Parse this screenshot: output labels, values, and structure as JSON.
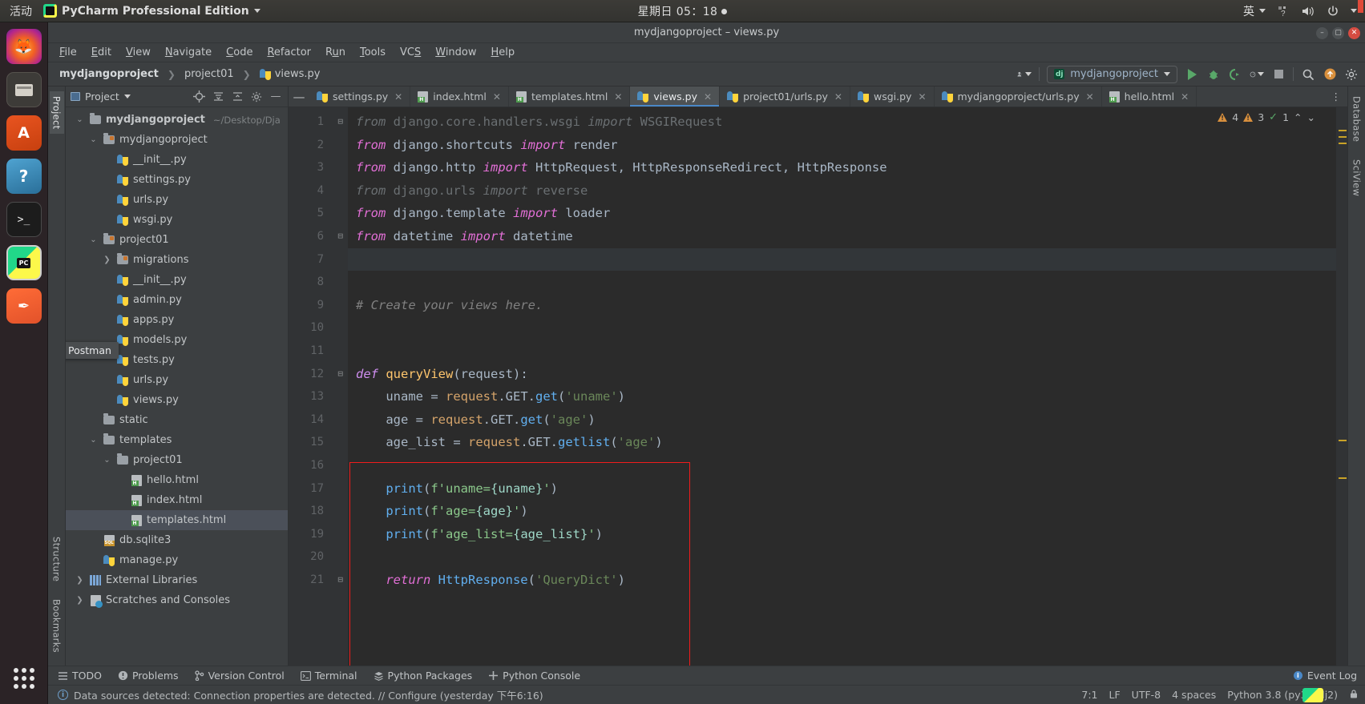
{
  "gnome": {
    "activities": "活动",
    "app_name": "PyCharm Professional Edition",
    "clock": "星期日 05：18",
    "input_method": "英"
  },
  "dock": {
    "items": [
      {
        "name": "firefox",
        "glyph": "🦊"
      },
      {
        "name": "files",
        "glyph": "🗄"
      },
      {
        "name": "ubuntu-software",
        "glyph": "A"
      },
      {
        "name": "help",
        "glyph": "?"
      },
      {
        "name": "terminal",
        "glyph": "▌"
      },
      {
        "name": "pycharm",
        "glyph": "PC"
      },
      {
        "name": "postman",
        "glyph": "✒"
      }
    ]
  },
  "window": {
    "title": "mydjangoproject – views.py"
  },
  "menu": {
    "items": [
      {
        "pre": "",
        "mn": "F",
        "post": "ile"
      },
      {
        "pre": "",
        "mn": "E",
        "post": "dit"
      },
      {
        "pre": "",
        "mn": "V",
        "post": "iew"
      },
      {
        "pre": "",
        "mn": "N",
        "post": "avigate"
      },
      {
        "pre": "",
        "mn": "C",
        "post": "ode"
      },
      {
        "pre": "",
        "mn": "R",
        "post": "efactor"
      },
      {
        "pre": "R",
        "mn": "u",
        "post": "n"
      },
      {
        "pre": "",
        "mn": "T",
        "post": "ools"
      },
      {
        "pre": "VC",
        "mn": "S",
        "post": ""
      },
      {
        "pre": "",
        "mn": "W",
        "post": "indow"
      },
      {
        "pre": "",
        "mn": "H",
        "post": "elp"
      }
    ]
  },
  "navbar": {
    "crumbs": [
      "mydjangoproject",
      "project01",
      "views.py"
    ],
    "run_config": "mydjangoproject"
  },
  "project_panel": {
    "title": "Project",
    "tree": [
      {
        "depth": 0,
        "arrow": "v",
        "icon": "folder",
        "label": "mydjangoproject",
        "path": "~/Desktop/Dja",
        "bold": true
      },
      {
        "depth": 1,
        "arrow": "v",
        "icon": "folder-mod",
        "label": "mydjangoproject",
        "path": "",
        "bold": false
      },
      {
        "depth": 2,
        "arrow": "",
        "icon": "py",
        "label": "__init__.py",
        "path": "",
        "bold": false
      },
      {
        "depth": 2,
        "arrow": "",
        "icon": "py",
        "label": "settings.py",
        "path": "",
        "bold": false
      },
      {
        "depth": 2,
        "arrow": "",
        "icon": "py",
        "label": "urls.py",
        "path": "",
        "bold": false
      },
      {
        "depth": 2,
        "arrow": "",
        "icon": "py",
        "label": "wsgi.py",
        "path": "",
        "bold": false
      },
      {
        "depth": 1,
        "arrow": "v",
        "icon": "folder-mod",
        "label": "project01",
        "path": "",
        "bold": false
      },
      {
        "depth": 2,
        "arrow": ">",
        "icon": "folder-mod",
        "label": "migrations",
        "path": "",
        "bold": false
      },
      {
        "depth": 2,
        "arrow": "",
        "icon": "py",
        "label": "__init__.py",
        "path": "",
        "bold": false
      },
      {
        "depth": 2,
        "arrow": "",
        "icon": "py",
        "label": "admin.py",
        "path": "",
        "bold": false
      },
      {
        "depth": 2,
        "arrow": "",
        "icon": "py",
        "label": "apps.py",
        "path": "",
        "bold": false
      },
      {
        "depth": 2,
        "arrow": "",
        "icon": "py",
        "label": "models.py",
        "path": "",
        "bold": false
      },
      {
        "depth": 2,
        "arrow": "",
        "icon": "py",
        "label": "tests.py",
        "path": "",
        "bold": false
      },
      {
        "depth": 2,
        "arrow": "",
        "icon": "py",
        "label": "urls.py",
        "path": "",
        "bold": false
      },
      {
        "depth": 2,
        "arrow": "",
        "icon": "py",
        "label": "views.py",
        "path": "",
        "bold": false
      },
      {
        "depth": 1,
        "arrow": "",
        "icon": "folder",
        "label": "static",
        "path": "",
        "bold": false
      },
      {
        "depth": 1,
        "arrow": "v",
        "icon": "folder",
        "label": "templates",
        "path": "",
        "bold": false
      },
      {
        "depth": 2,
        "arrow": "v",
        "icon": "folder",
        "label": "project01",
        "path": "",
        "bold": false
      },
      {
        "depth": 3,
        "arrow": "",
        "icon": "html",
        "label": "hello.html",
        "path": "",
        "bold": false
      },
      {
        "depth": 3,
        "arrow": "",
        "icon": "html",
        "label": "index.html",
        "path": "",
        "bold": false
      },
      {
        "depth": 3,
        "arrow": "",
        "icon": "html",
        "label": "templates.html",
        "path": "",
        "bold": false,
        "selected": true
      },
      {
        "depth": 1,
        "arrow": "",
        "icon": "sql",
        "label": "db.sqlite3",
        "path": "",
        "bold": false
      },
      {
        "depth": 1,
        "arrow": "",
        "icon": "py",
        "label": "manage.py",
        "path": "",
        "bold": false
      },
      {
        "depth": 0,
        "arrow": ">",
        "icon": "lib",
        "label": "External Libraries",
        "path": "",
        "bold": false
      },
      {
        "depth": 0,
        "arrow": ">",
        "icon": "scratch",
        "label": "Scratches and Consoles",
        "path": "",
        "bold": false
      }
    ],
    "tooltip": "Postman"
  },
  "left_strip": {
    "tabs": [
      "Project",
      "Structure",
      "Bookmarks"
    ]
  },
  "right_strip": {
    "tabs": [
      "Database",
      "SciView"
    ]
  },
  "tabs": [
    {
      "label": "settings.py",
      "icon": "py",
      "active": false
    },
    {
      "label": "index.html",
      "icon": "html",
      "active": false
    },
    {
      "label": "templates.html",
      "icon": "html",
      "active": false
    },
    {
      "label": "views.py",
      "icon": "py",
      "active": true
    },
    {
      "label": "project01/urls.py",
      "icon": "py",
      "active": false
    },
    {
      "label": "wsgi.py",
      "icon": "py",
      "active": false
    },
    {
      "label": "mydjangoproject/urls.py",
      "icon": "py",
      "active": false
    },
    {
      "label": "hello.html",
      "icon": "html",
      "active": false
    }
  ],
  "inspections": {
    "warnings": "4",
    "weak_warnings": "3",
    "typos": "1"
  },
  "code": {
    "lines": [
      {
        "n": 1,
        "fold": "minus",
        "tokens": [
          {
            "t": "from ",
            "c": "dim"
          },
          {
            "t": "django.core.handlers.wsgi ",
            "c": "dim2"
          },
          {
            "t": "import ",
            "c": "dim"
          },
          {
            "t": "WSGIRequest",
            "c": "dim2"
          }
        ]
      },
      {
        "n": 2,
        "fold": "",
        "tokens": [
          {
            "t": "from ",
            "c": "kw"
          },
          {
            "t": "django.shortcuts ",
            "c": "idn"
          },
          {
            "t": "import ",
            "c": "kw"
          },
          {
            "t": "render",
            "c": "idn"
          }
        ]
      },
      {
        "n": 3,
        "fold": "",
        "tokens": [
          {
            "t": "from ",
            "c": "kw"
          },
          {
            "t": "django.http ",
            "c": "idn"
          },
          {
            "t": "import ",
            "c": "kw"
          },
          {
            "t": "HttpRequest, HttpResponseRedirect, HttpResponse",
            "c": "idn"
          }
        ]
      },
      {
        "n": 4,
        "fold": "",
        "tokens": [
          {
            "t": "from ",
            "c": "dim"
          },
          {
            "t": "django.urls ",
            "c": "dim2"
          },
          {
            "t": "import ",
            "c": "dim"
          },
          {
            "t": "reverse",
            "c": "dim2"
          }
        ]
      },
      {
        "n": 5,
        "fold": "",
        "tokens": [
          {
            "t": "from ",
            "c": "kw"
          },
          {
            "t": "django.template ",
            "c": "idn"
          },
          {
            "t": "import ",
            "c": "kw"
          },
          {
            "t": "loader",
            "c": "idn"
          }
        ]
      },
      {
        "n": 6,
        "fold": "minus",
        "tokens": [
          {
            "t": "from ",
            "c": "kw"
          },
          {
            "t": "datetime ",
            "c": "idn"
          },
          {
            "t": "import ",
            "c": "kw"
          },
          {
            "t": "datetime",
            "c": "idn"
          }
        ]
      },
      {
        "n": 7,
        "fold": "",
        "tokens": [],
        "current": true
      },
      {
        "n": 8,
        "fold": "",
        "tokens": []
      },
      {
        "n": 9,
        "fold": "",
        "tokens": [
          {
            "t": "# Create your views here.",
            "c": "cm"
          }
        ]
      },
      {
        "n": 10,
        "fold": "",
        "tokens": []
      },
      {
        "n": 11,
        "fold": "",
        "tokens": []
      },
      {
        "n": 12,
        "fold": "minus",
        "tokens": [
          {
            "t": "def ",
            "c": "kw2"
          },
          {
            "t": "queryView",
            "c": "fn"
          },
          {
            "t": "(",
            "c": "brc"
          },
          {
            "t": "request",
            "c": "idn"
          },
          {
            "t": "):",
            "c": "brc"
          }
        ]
      },
      {
        "n": 13,
        "fold": "",
        "tokens": [
          {
            "t": "    uname ",
            "c": "idn"
          },
          {
            "t": "= ",
            "c": "brc"
          },
          {
            "t": "request",
            "c": "attr"
          },
          {
            "t": ".GET.",
            "c": "idn"
          },
          {
            "t": "get",
            "c": "call"
          },
          {
            "t": "(",
            "c": "brc"
          },
          {
            "t": "'uname'",
            "c": "str"
          },
          {
            "t": ")",
            "c": "brc"
          }
        ]
      },
      {
        "n": 14,
        "fold": "",
        "tokens": [
          {
            "t": "    age ",
            "c": "idn"
          },
          {
            "t": "= ",
            "c": "brc"
          },
          {
            "t": "request",
            "c": "attr"
          },
          {
            "t": ".GET.",
            "c": "idn"
          },
          {
            "t": "get",
            "c": "call"
          },
          {
            "t": "(",
            "c": "brc"
          },
          {
            "t": "'age'",
            "c": "str"
          },
          {
            "t": ")",
            "c": "brc"
          }
        ]
      },
      {
        "n": 15,
        "fold": "",
        "tokens": [
          {
            "t": "    age_list ",
            "c": "idn"
          },
          {
            "t": "= ",
            "c": "brc"
          },
          {
            "t": "request",
            "c": "attr"
          },
          {
            "t": ".GET.",
            "c": "idn"
          },
          {
            "t": "getlist",
            "c": "call"
          },
          {
            "t": "(",
            "c": "brc"
          },
          {
            "t": "'age'",
            "c": "str"
          },
          {
            "t": ")",
            "c": "brc"
          }
        ]
      },
      {
        "n": 16,
        "fold": "",
        "tokens": []
      },
      {
        "n": 17,
        "fold": "",
        "tokens": [
          {
            "t": "    print",
            "c": "call"
          },
          {
            "t": "(",
            "c": "brc"
          },
          {
            "t": "f'uname=",
            "c": "fstr"
          },
          {
            "t": "{uname}",
            "c": "fexp"
          },
          {
            "t": "'",
            "c": "fstr"
          },
          {
            "t": ")",
            "c": "brc"
          }
        ]
      },
      {
        "n": 18,
        "fold": "",
        "tokens": [
          {
            "t": "    print",
            "c": "call"
          },
          {
            "t": "(",
            "c": "brc"
          },
          {
            "t": "f'age=",
            "c": "fstr"
          },
          {
            "t": "{age}",
            "c": "fexp"
          },
          {
            "t": "'",
            "c": "fstr"
          },
          {
            "t": ")",
            "c": "brc"
          }
        ]
      },
      {
        "n": 19,
        "fold": "",
        "tokens": [
          {
            "t": "    print",
            "c": "call"
          },
          {
            "t": "(",
            "c": "brc"
          },
          {
            "t": "f'age_list=",
            "c": "fstr"
          },
          {
            "t": "{age_list}",
            "c": "fexp"
          },
          {
            "t": "'",
            "c": "fstr"
          },
          {
            "t": ")",
            "c": "brc"
          }
        ]
      },
      {
        "n": 20,
        "fold": "",
        "tokens": []
      },
      {
        "n": 21,
        "fold": "minus",
        "tokens": [
          {
            "t": "    return ",
            "c": "kw"
          },
          {
            "t": "HttpResponse",
            "c": "call"
          },
          {
            "t": "(",
            "c": "brc"
          },
          {
            "t": "'QueryDict'",
            "c": "str"
          },
          {
            "t": ")",
            "c": "brc"
          }
        ]
      }
    ]
  },
  "toolstrip": {
    "items": [
      {
        "label": "TODO",
        "icon": "todo-icon"
      },
      {
        "label": "Problems",
        "icon": "problems-icon"
      },
      {
        "label": "Version Control",
        "icon": "vcs-icon"
      },
      {
        "label": "Terminal",
        "icon": "terminal-icon"
      },
      {
        "label": "Python Packages",
        "icon": "packages-icon"
      },
      {
        "label": "Python Console",
        "icon": "console-icon"
      }
    ],
    "event_log": "Event Log"
  },
  "statusbar": {
    "message": "Data sources detected: Connection properties are detected. // Configure (yesterday 下午6:16)",
    "caret": "7:1",
    "line_sep": "LF",
    "encoding": "UTF-8",
    "indent": "4 spaces",
    "interpreter": "Python 3.8 (py38_dj2)"
  }
}
